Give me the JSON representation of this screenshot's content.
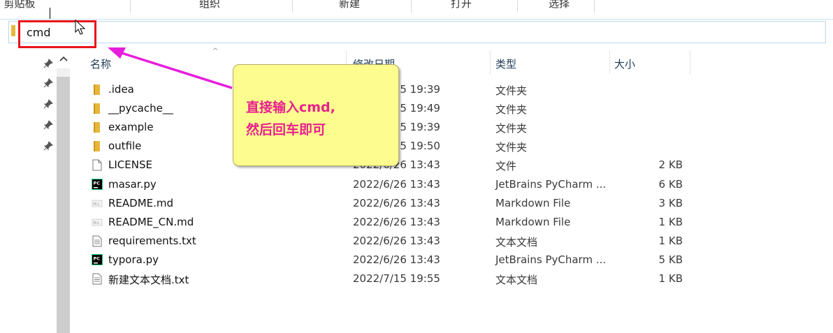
{
  "ribbon": {
    "groups": [
      "剪贴板",
      "组织",
      "新建",
      "打开",
      "选择"
    ]
  },
  "address_bar": {
    "value": "cmd"
  },
  "columns": {
    "name": "名称",
    "date": "修改日期",
    "type": "类型",
    "size": "大小"
  },
  "files": [
    {
      "name": ".idea",
      "date": "2022/7/15 19:39",
      "type": "文件夹",
      "size": "",
      "icon": "folder-icon"
    },
    {
      "name": "__pycache__",
      "date": "2022/7/15 19:49",
      "type": "文件夹",
      "size": "",
      "icon": "folder-icon"
    },
    {
      "name": "example",
      "date": "2022/7/15 19:39",
      "type": "文件夹",
      "size": "",
      "icon": "folder-icon"
    },
    {
      "name": "outfile",
      "date": "2022/7/15 19:50",
      "type": "文件夹",
      "size": "",
      "icon": "folder-icon"
    },
    {
      "name": "LICENSE",
      "date": "2022/6/26 13:43",
      "type": "文件",
      "size": "2 KB",
      "icon": "blank-file-icon"
    },
    {
      "name": "masar.py",
      "date": "2022/6/26 13:43",
      "type": "JetBrains PyCharm ...",
      "size": "6 KB",
      "icon": "pycharm-file-icon"
    },
    {
      "name": "README.md",
      "date": "2022/6/26 13:43",
      "type": "Markdown File",
      "size": "3 KB",
      "icon": "markdown-file-icon"
    },
    {
      "name": "README_CN.md",
      "date": "2022/6/26 13:43",
      "type": "Markdown File",
      "size": "1 KB",
      "icon": "markdown-file-icon"
    },
    {
      "name": "requirements.txt",
      "date": "2022/6/26 13:43",
      "type": "文本文档",
      "size": "1 KB",
      "icon": "text-file-icon"
    },
    {
      "name": "typora.py",
      "date": "2022/6/26 13:43",
      "type": "JetBrains PyCharm ...",
      "size": "5 KB",
      "icon": "pycharm-file-icon"
    },
    {
      "name": "新建文本文档.txt",
      "date": "2022/7/15 19:55",
      "type": "文本文档",
      "size": "1 KB",
      "icon": "text-file-icon"
    }
  ],
  "callout": {
    "line1": "直接输入cmd,",
    "line2": "然后回车即可"
  },
  "colors": {
    "annotation_red": "#e8141b",
    "annotation_magenta": "#e61edc",
    "callout_bg": "#fdfd8f",
    "callout_text": "#e8218d",
    "folder": "#e8b73a"
  }
}
